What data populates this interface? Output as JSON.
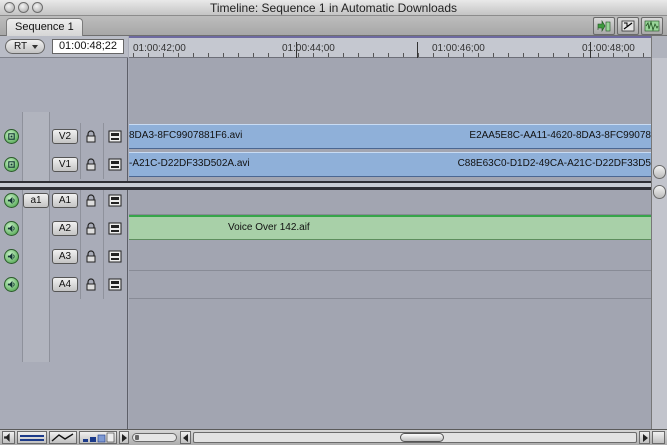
{
  "window": {
    "title": "Timeline: Sequence 1 in Automatic Downloads"
  },
  "tabs": [
    {
      "label": "Sequence 1"
    }
  ],
  "toolbar": {
    "rt_label": "RT",
    "timecode": "01:00:48;22"
  },
  "ruler": {
    "labels": [
      "01:00:42;00",
      "01:00:44;00",
      "01:00:46;00",
      "01:00:48;00"
    ]
  },
  "tracks": {
    "video": [
      {
        "label": "V2",
        "clip_left": "8DA3-8FC9907881F6.avi",
        "clip_right": "E2AA5E8C-AA11-4620-8DA3-8FC99078"
      },
      {
        "label": "V1",
        "clip_left": "-A21C-D22DF33D502A.avi",
        "clip_right": "C88E63C0-D1D2-49CA-A21C-D22DF33D5"
      }
    ],
    "audio": [
      {
        "label": "A1",
        "source": "a1",
        "clip": ""
      },
      {
        "label": "A2",
        "clip": "Voice Over 142.aif"
      },
      {
        "label": "A3",
        "clip": ""
      },
      {
        "label": "A4",
        "clip": ""
      }
    ]
  },
  "colors": {
    "video_clip": "#8fb0d9",
    "audio_clip": "#a8d0a8",
    "enabled_green": "#3f9a3f"
  }
}
